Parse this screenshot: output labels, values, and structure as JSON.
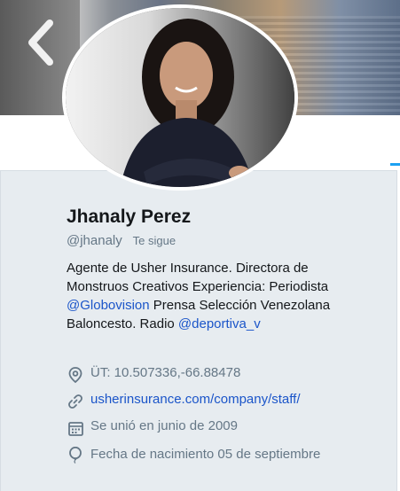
{
  "profile": {
    "name": "Jhanaly Perez",
    "handle": "@jhanaly",
    "follows_you": "Te sigue",
    "bio": {
      "part1": "Agente de Usher Insurance. Directora de Monstruos Creativos Experiencia: Periodista ",
      "mention1": "@Globovision",
      "part2": " Prensa Selección Venezolana Baloncesto. Radio ",
      "mention2": "@deportiva_v"
    },
    "location": "ÜT: 10.507336,-66.88478",
    "website": "usherinsurance.com/company/staff/",
    "joined": "Se unió en junio de 2009",
    "birthday": "Fecha de nacimiento 05 de septiembre"
  },
  "icons": {
    "back": "chevron-left-icon",
    "location": "location-pin-icon",
    "website": "link-icon",
    "joined": "calendar-icon",
    "birthday": "balloon-icon"
  },
  "colors": {
    "link": "#1b55c9",
    "card_bg": "#e7ecf0",
    "muted": "#657786",
    "accent": "#1da1f2"
  }
}
